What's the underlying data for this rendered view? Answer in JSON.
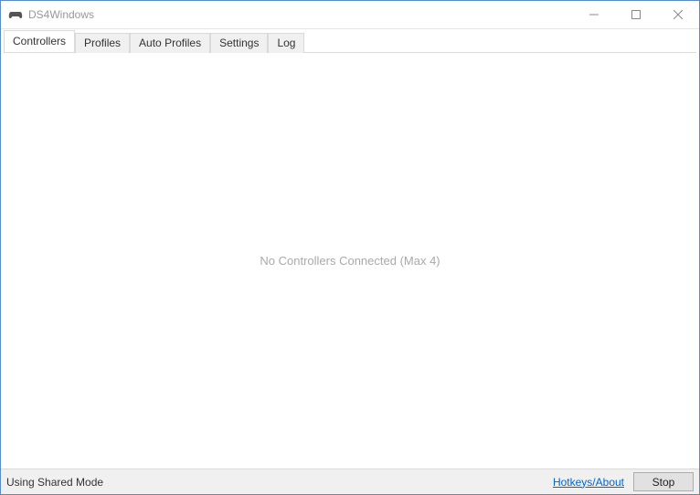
{
  "window": {
    "title": "DS4Windows"
  },
  "tabs": {
    "controllers": "Controllers",
    "profiles": "Profiles",
    "autoProfiles": "Auto Profiles",
    "settings": "Settings",
    "log": "Log",
    "active": "controllers"
  },
  "content": {
    "emptyMessage": "No Controllers Connected (Max 4)"
  },
  "statusbar": {
    "mode": "Using Shared Mode",
    "hotkeysLink": "Hotkeys/About",
    "stopLabel": "Stop"
  }
}
